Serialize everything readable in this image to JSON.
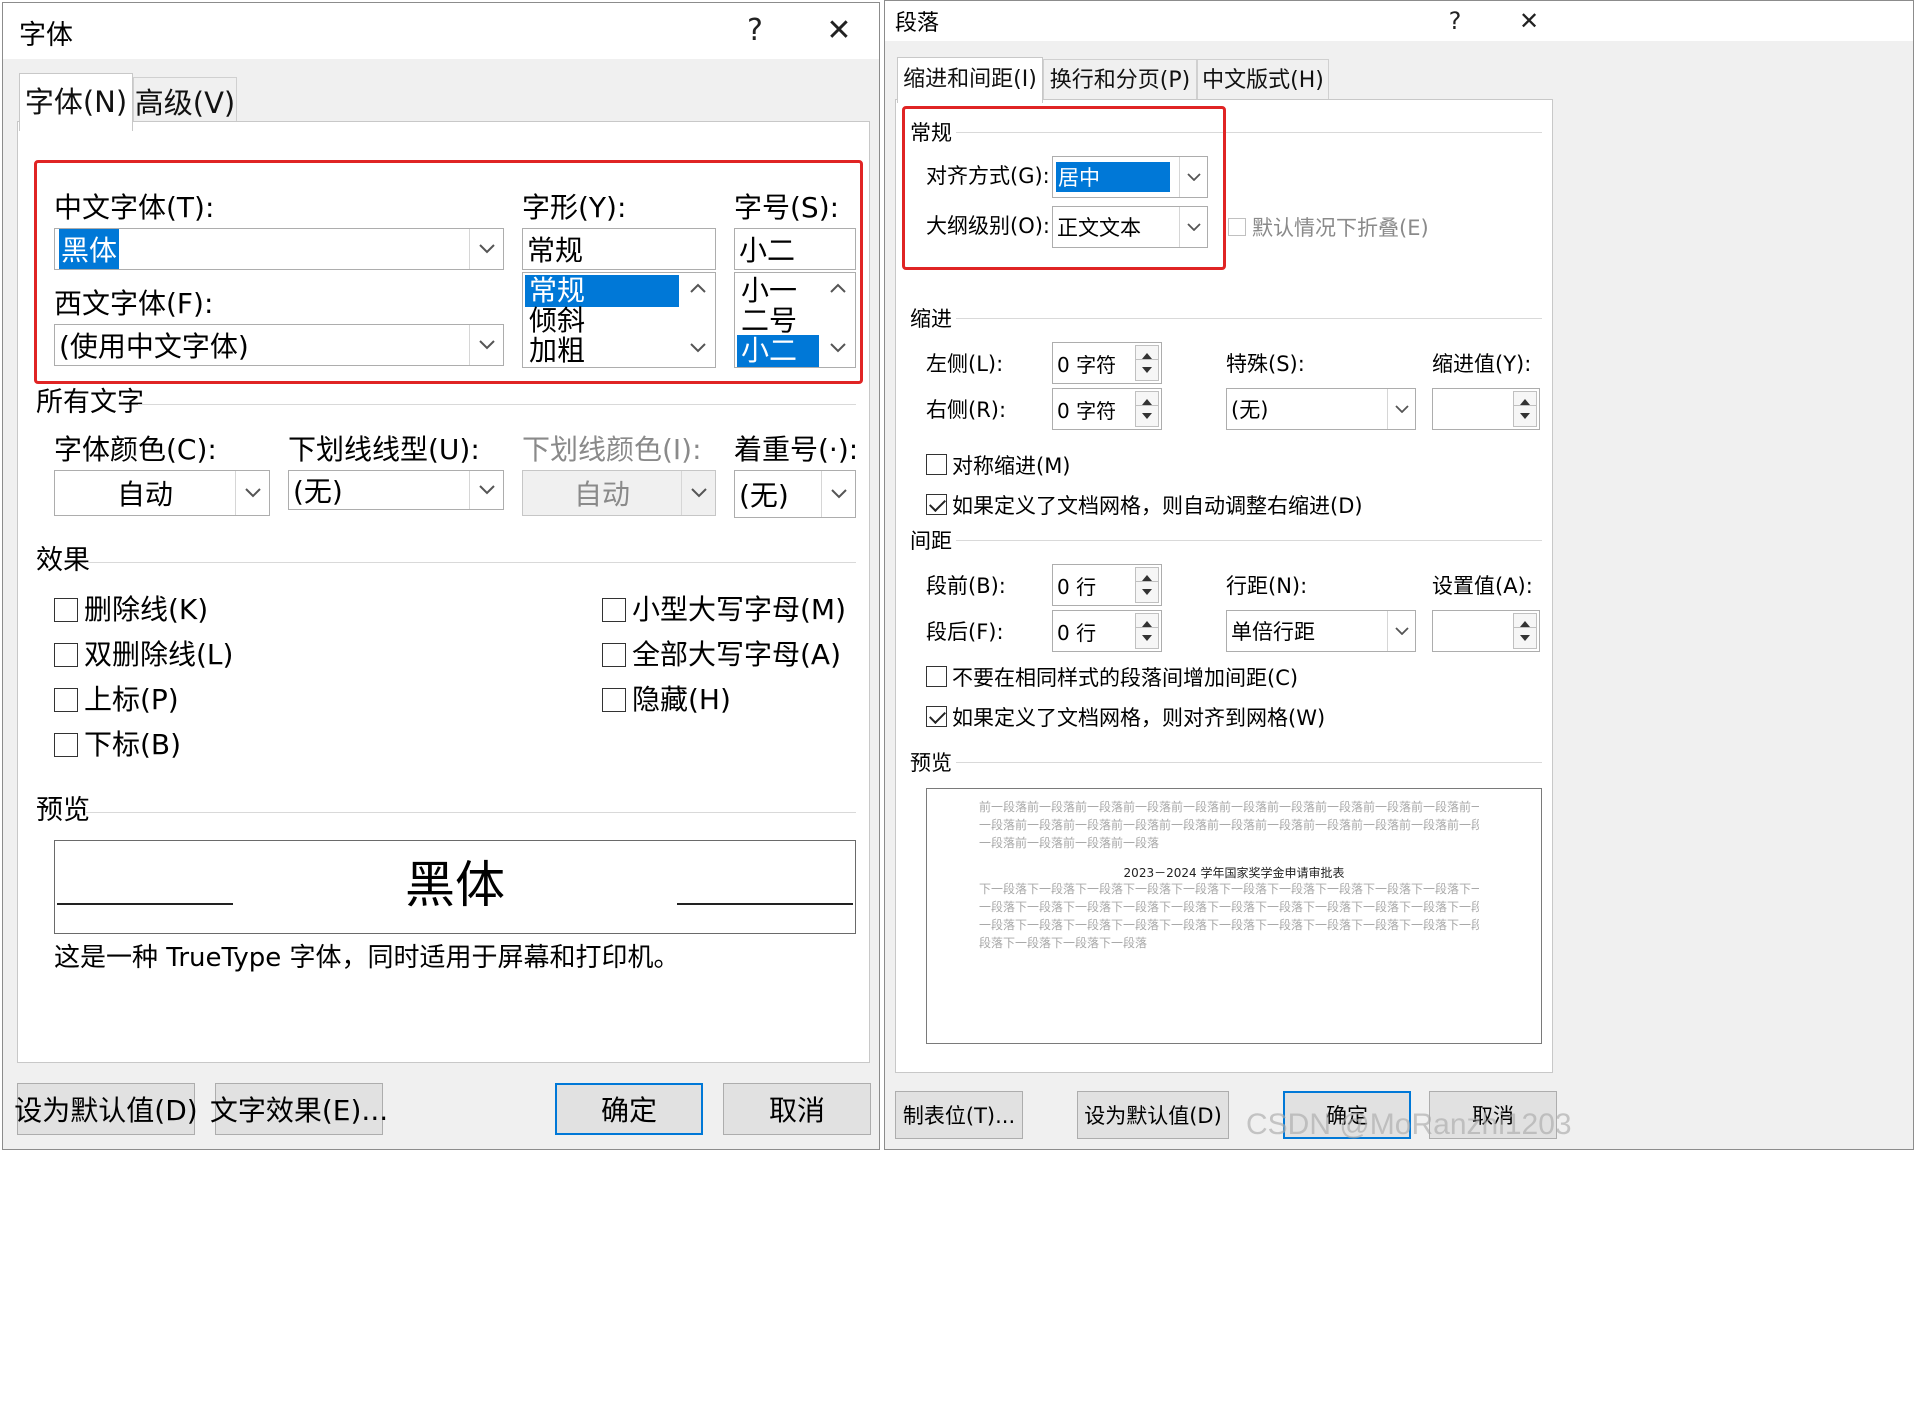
{
  "font_dialog": {
    "title": "字体",
    "help": "?",
    "close": "✕",
    "tabs": [
      "字体(N)",
      "高级(V)"
    ],
    "chinese_font": {
      "label": "中文字体(T):",
      "value": "黑体"
    },
    "western_font": {
      "label": "西文字体(F):",
      "value": "(使用中文字体)"
    },
    "style": {
      "label": "字形(Y):",
      "value": "常规",
      "options": [
        "常规",
        "倾斜",
        "加粗"
      ],
      "selected_index": 0
    },
    "size": {
      "label": "字号(S):",
      "value": "小二",
      "options": [
        "小一",
        "二号",
        "小二"
      ],
      "selected_index": 2
    },
    "all_text": {
      "section": "所有文字",
      "font_color": {
        "label": "字体颜色(C):",
        "value": "自动"
      },
      "underline_style": {
        "label": "下划线线型(U):",
        "value": "(无)"
      },
      "underline_color": {
        "label": "下划线颜色(I):",
        "value": "自动"
      },
      "emphasis": {
        "label": "着重号(·):",
        "value": "(无)"
      }
    },
    "effects": {
      "section": "效果",
      "left": [
        {
          "label": "删除线(K)",
          "checked": false
        },
        {
          "label": "双删除线(L)",
          "checked": false
        },
        {
          "label": "上标(P)",
          "checked": false
        },
        {
          "label": "下标(B)",
          "checked": false
        }
      ],
      "right": [
        {
          "label": "小型大写字母(M)",
          "checked": false
        },
        {
          "label": "全部大写字母(A)",
          "checked": false
        },
        {
          "label": "隐藏(H)",
          "checked": false
        }
      ]
    },
    "preview": {
      "section": "预览",
      "sample": "黑体",
      "note": "这是一种 TrueType 字体，同时适用于屏幕和打印机。"
    },
    "buttons": {
      "set_default": "设为默认值(D)",
      "text_effects": "文字效果(E)...",
      "ok": "确定",
      "cancel": "取消"
    }
  },
  "paragraph_dialog": {
    "title": "段落",
    "help": "?",
    "close": "✕",
    "tabs": [
      "缩进和间距(I)",
      "换行和分页(P)",
      "中文版式(H)"
    ],
    "general": {
      "section": "常规",
      "alignment": {
        "label": "对齐方式(G):",
        "value": "居中"
      },
      "outline_level": {
        "label": "大纲级别(O):",
        "value": "正文文本"
      },
      "collapse": {
        "label": "默认情况下折叠(E)",
        "checked": false
      }
    },
    "indent": {
      "section": "缩进",
      "left": {
        "label": "左侧(L):",
        "value": "0 字符"
      },
      "right": {
        "label": "右侧(R):",
        "value": "0 字符"
      },
      "special": {
        "label": "特殊(S):",
        "value": "(无)"
      },
      "indent_value": {
        "label": "缩进值(Y):",
        "value": ""
      },
      "mirror": {
        "label": "对称缩进(M)",
        "checked": false
      },
      "auto_adjust": {
        "label": "如果定义了文档网格，则自动调整右缩进(D)",
        "checked": true
      }
    },
    "spacing": {
      "section": "间距",
      "before": {
        "label": "段前(B):",
        "value": "0 行"
      },
      "after": {
        "label": "段后(F):",
        "value": "0 行"
      },
      "line_spacing": {
        "label": "行距(N):",
        "value": "单倍行距"
      },
      "at": {
        "label": "设置值(A):",
        "value": ""
      },
      "no_space_same_style": {
        "label": "不要在相同样式的段落间增加间距(C)",
        "checked": false
      },
      "snap_grid": {
        "label": "如果定义了文档网格，则对齐到网格(W)",
        "checked": true
      }
    },
    "preview": {
      "section": "预览",
      "prev_lines": [
        "前一段落前一段落前一段落前一段落前一段落前一段落前一段落前一段落前一段落前一段落前一段落前一段落",
        "一段落前一段落前一段落前一段落前一段落前一段落前一段落前一段落前一段落前一段落前一段落前一段落",
        "一段落前一段落前一段落前一段落"
      ],
      "current": "2023－2024 学年国家奖学金申请审批表",
      "next_lines": [
        "下一段落下一段落下一段落下一段落下一段落下一段落下一段落下一段落下一段落下一段落下一段落下一段落",
        "一段落下一段落下一段落下一段落下一段落下一段落下一段落下一段落下一段落下一段落下一段落下一段落下",
        "一段落下一段落下一段落下一段落下一段落下一段落下一段落下一段落下一段落下一段落下一段落下一段落",
        "段落下一段落下一段落下一段落"
      ]
    },
    "buttons": {
      "tabs": "制表位(T)...",
      "set_default": "设为默认值(D)",
      "ok": "确定",
      "cancel": "取消"
    }
  },
  "watermark": "CSDN @MoRanzhi1203",
  "colors": {
    "accent": "#0078d7",
    "highlight_box": "#e02424",
    "dialog_bg": "#f0f0f0"
  }
}
